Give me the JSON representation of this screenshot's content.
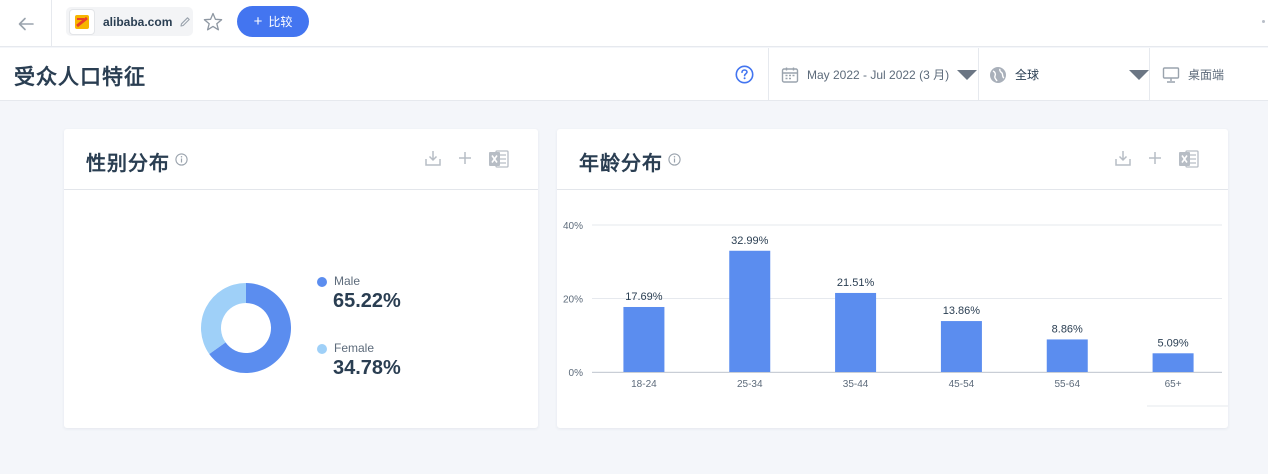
{
  "topbar": {
    "site": "alibaba.com",
    "compare_label": "比较"
  },
  "header": {
    "title": "受众人口特征",
    "date_range": "May 2022 - Jul 2022 (3 月)",
    "region": "全球",
    "device": "桌面端"
  },
  "gender_card": {
    "title": "性别分布",
    "male_label": "Male",
    "male_pct": "65.22%",
    "female_label": "Female",
    "female_pct": "34.78%"
  },
  "age_card": {
    "title": "年龄分布"
  },
  "colors": {
    "accent": "#4375f0",
    "male": "#5b8def",
    "female": "#9fd0f8"
  },
  "chart_data": [
    {
      "type": "pie",
      "variant": "donut",
      "labels": [
        "Male",
        "Female"
      ],
      "values": [
        65.22,
        34.78
      ]
    },
    {
      "type": "bar",
      "categories": [
        "18-24",
        "25-34",
        "35-44",
        "45-54",
        "55-64",
        "65+"
      ],
      "values": [
        17.69,
        32.99,
        21.51,
        13.86,
        8.86,
        5.09
      ],
      "data_labels": [
        "17.69%",
        "32.99%",
        "21.51%",
        "13.86%",
        "8.86%",
        "5.09%"
      ],
      "y_ticks": [
        "0%",
        "20%",
        "40%"
      ],
      "ylim": [
        0,
        40
      ],
      "grid": true
    }
  ]
}
